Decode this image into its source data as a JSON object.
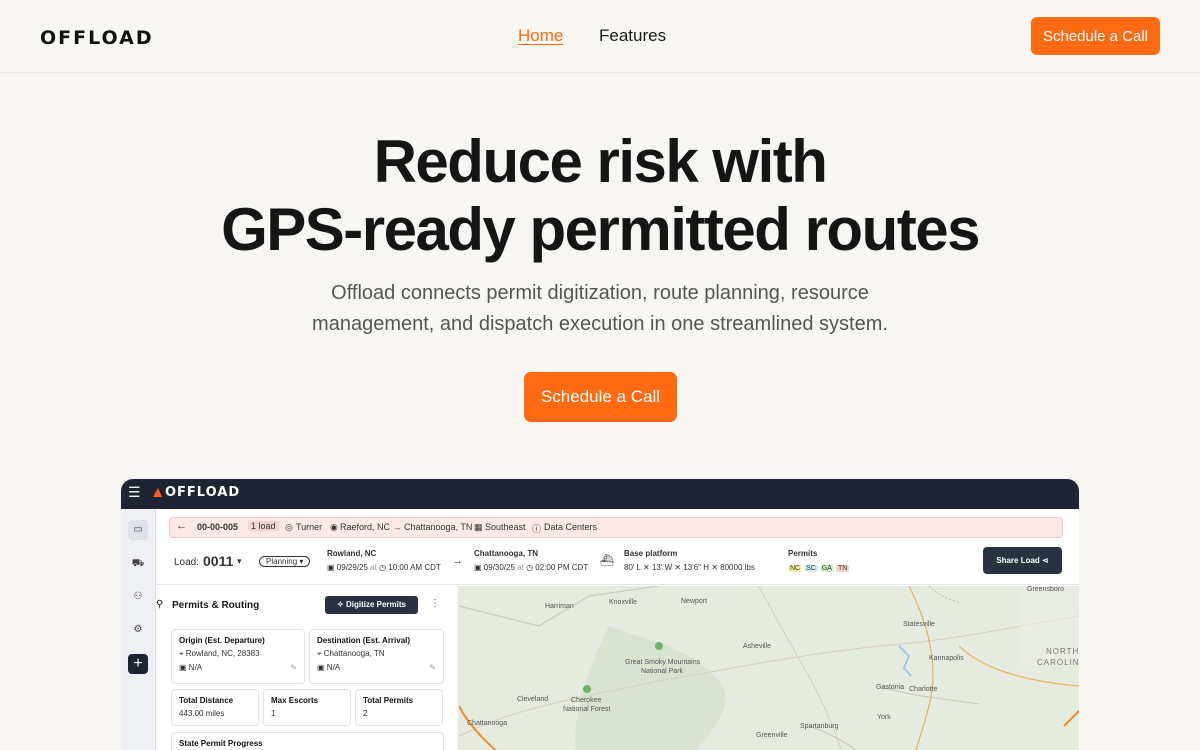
{
  "nav": {
    "logo": "OFFLOAD",
    "links": [
      "Home",
      "Features"
    ],
    "cta": "Schedule a Call"
  },
  "hero": {
    "title_line1": "Reduce risk with",
    "title_line2": "GPS-ready permitted routes",
    "subtitle": "Offload connects permit digitization, route planning, resource management, and dispatch execution in one streamlined system.",
    "cta": "Schedule a Call"
  },
  "app": {
    "logo": "OFFLOAD",
    "breadcrumb": {
      "load_id": "00-00-005",
      "load_count": "1 load",
      "customer": "Turner",
      "route": "Raeford, NC → Chattanooga, TN",
      "region": "Southeast",
      "category": "Data Centers"
    },
    "load": {
      "label": "Load:",
      "number": "0011",
      "status": "Planning",
      "origin_city": "Rowland, NC",
      "origin_date": "09/29/25",
      "origin_time": "10:00 AM CDT",
      "at": "at",
      "dest_city": "Chattanooga, TN",
      "dest_date": "09/30/25",
      "dest_time": "02:00 PM CDT",
      "platform_title": "Base platform",
      "platform_dims": "80' L  ✕  13' W  ✕  13'6\" H  ✕  80000 lbs",
      "permits_title": "Permits",
      "permit_states": [
        "NC",
        "SC",
        "GA",
        "TN"
      ],
      "share": "Share Load"
    },
    "panel": {
      "title": "Permits & Routing",
      "digitize": "Digitize Permits",
      "origin_title": "Origin (Est. Departure)",
      "origin_addr": "Rowland, NC, 28383",
      "origin_time": "N/A",
      "dest_title": "Destination (Est. Arrival)",
      "dest_addr": "Chattanooga, TN",
      "dest_time": "N/A",
      "distance_title": "Total Distance",
      "distance_value": "443.00 miles",
      "escorts_title": "Max Escorts",
      "escorts_value": "1",
      "permits_title": "Total Permits",
      "permits_value": "2",
      "progress_title": "State Permit Progress"
    },
    "map_labels": {
      "harriman": "Harriman",
      "knoxville": "Knoxville",
      "newport": "Newport",
      "greensboro": "Greensboro",
      "statesville": "Statesville",
      "asheville": "Asheville",
      "smoky": "Great Smoky Mountains",
      "park": "National Park",
      "kannapolis": "Kannapolis",
      "north": "NORTH",
      "carolina": "CAROLINA",
      "cleveland": "Cleveland",
      "cherokee": "Cherokee",
      "nforest": "National Forest",
      "gastonia": "Gastonia",
      "charlotte": "Charlotte",
      "chattanooga": "Chattanooga",
      "york": "York",
      "spartanburg": "Spartanburg",
      "greenville": "Greenville"
    }
  }
}
